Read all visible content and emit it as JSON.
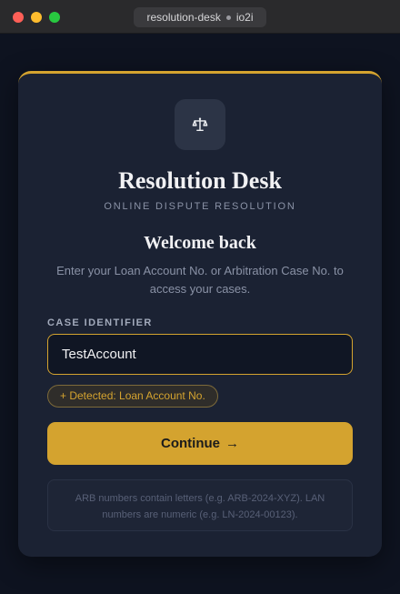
{
  "window": {
    "tab_title": "resolution-desk",
    "tab_suffix": "io2i"
  },
  "brand": {
    "icon": "scales-icon",
    "title": "Resolution Desk",
    "subtitle": "ONLINE DISPUTE RESOLUTION"
  },
  "login": {
    "heading": "Welcome back",
    "instructions": "Enter your Loan Account No. or Arbitration Case No. to access your cases.",
    "field_label": "CASE IDENTIFIER",
    "input_value": "TestAccount",
    "detected_badge": "+ Detected: Loan Account No.",
    "continue_label": "Continue",
    "continue_arrow": "→",
    "hint": "ARB numbers contain letters (e.g. ARB-2024-XYZ). LAN numbers are numeric (e.g. LN-2024-00123)."
  },
  "colors": {
    "accent": "#d4a32f",
    "card_background": "#1b2233",
    "page_background": "#0e1320"
  }
}
